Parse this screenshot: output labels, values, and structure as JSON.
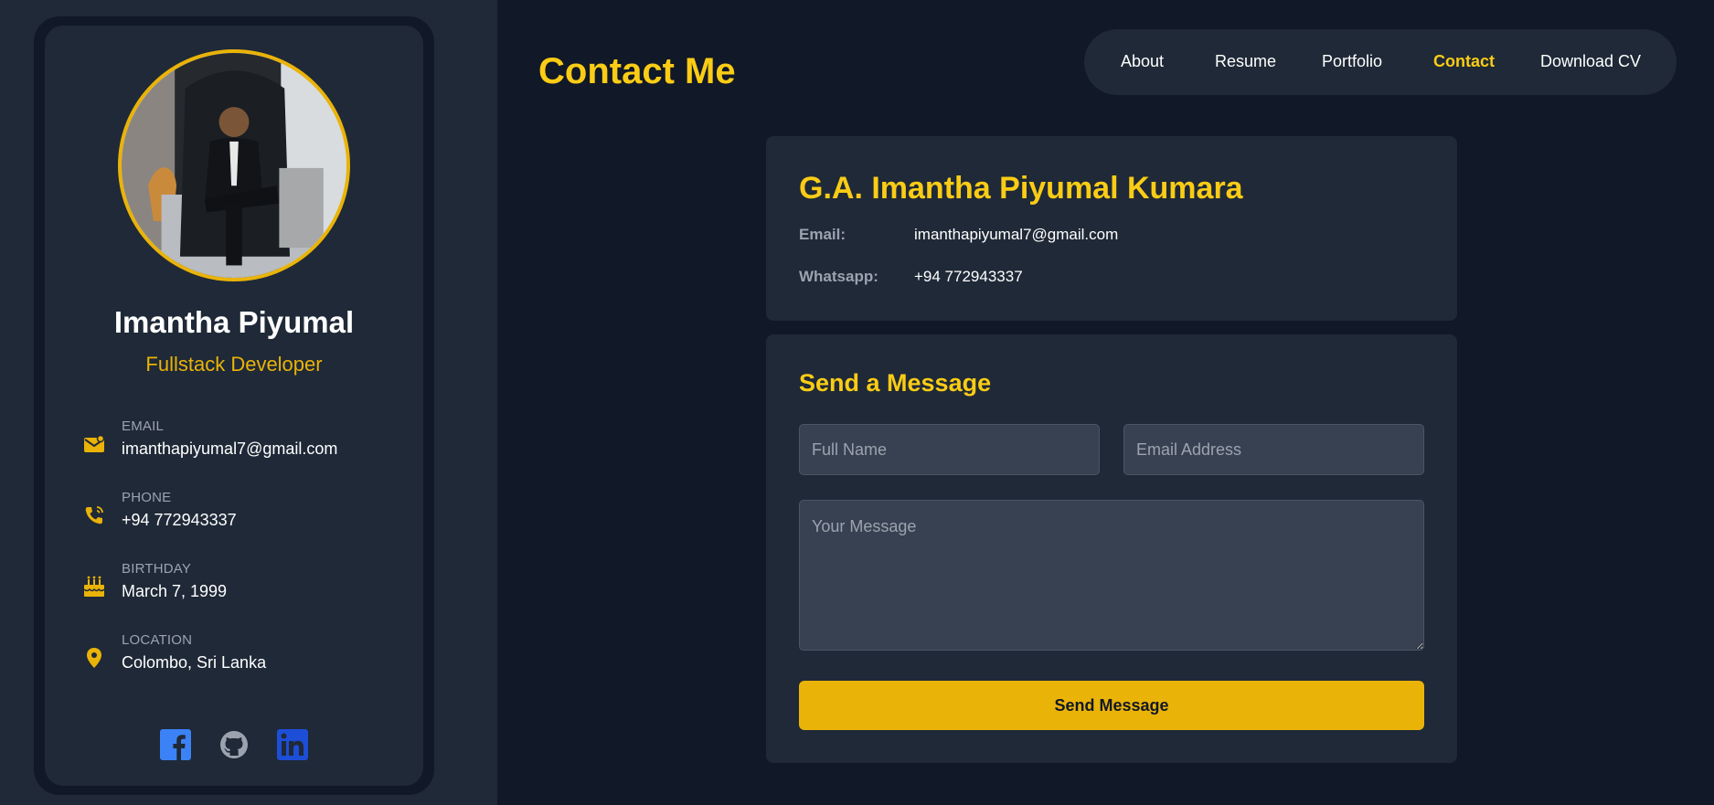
{
  "profile": {
    "name": "Imantha Piyumal",
    "role": "Fullstack Developer",
    "info": [
      {
        "label": "EMAIL",
        "value": "imanthapiyumal7@gmail.com",
        "icon": "envelope-icon"
      },
      {
        "label": "PHONE",
        "value": "+94 772943337",
        "icon": "phone-icon"
      },
      {
        "label": "BIRTHDAY",
        "value": "March 7, 1999",
        "icon": "cake-icon"
      },
      {
        "label": "LOCATION",
        "value": "Colombo, Sri Lanka",
        "icon": "location-pin-icon"
      }
    ],
    "socials": [
      "facebook-icon",
      "github-icon",
      "linkedin-icon"
    ]
  },
  "header": {
    "title": "Contact Me"
  },
  "nav": {
    "items": [
      {
        "label": "About"
      },
      {
        "label": "Resume"
      },
      {
        "label": "Portfolio"
      },
      {
        "label": "Contact",
        "active": true
      },
      {
        "label": "Download CV"
      }
    ]
  },
  "contact": {
    "name": "G.A. Imantha Piyumal Kumara",
    "email_label": "Email:",
    "email": "imanthapiyumal7@gmail.com",
    "whatsapp_label": "Whatsapp:",
    "whatsapp": "+94 772943337"
  },
  "message_form": {
    "title": "Send a Message",
    "name_placeholder": "Full Name",
    "email_placeholder": "Email Address",
    "message_placeholder": "Your Message",
    "submit_label": "Send Message"
  },
  "colors": {
    "accent": "#facc15",
    "button": "#eab308",
    "background": "#111827",
    "panel": "#1f2937",
    "input": "#374151"
  }
}
